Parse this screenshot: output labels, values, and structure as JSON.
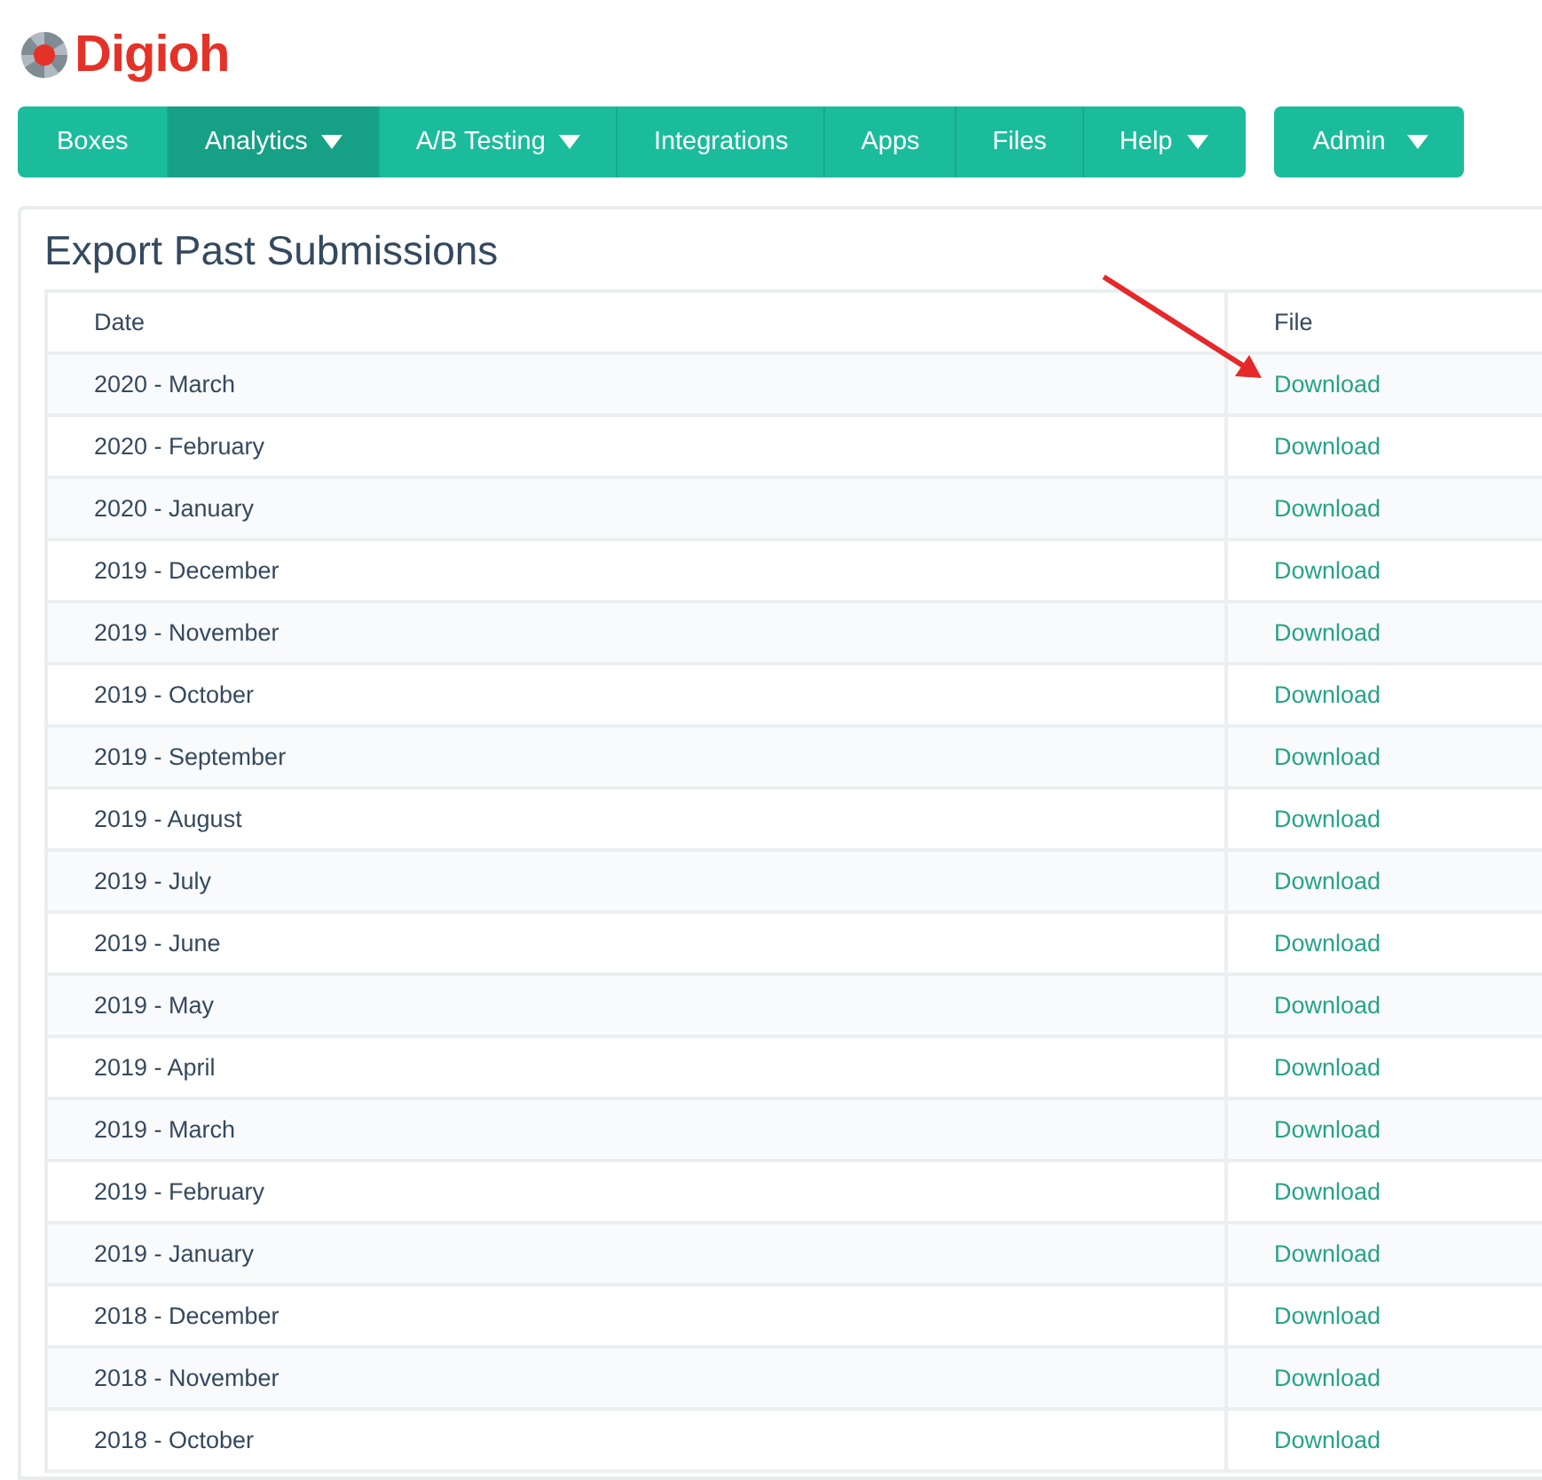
{
  "logo": {
    "text": "Digioh"
  },
  "nav": {
    "items": [
      {
        "label": "Boxes",
        "selected": false,
        "dropdown": false
      },
      {
        "label": "Analytics",
        "selected": true,
        "dropdown": true
      },
      {
        "label": "A/B Testing",
        "selected": false,
        "dropdown": true
      },
      {
        "label": "Integrations",
        "selected": false,
        "dropdown": false
      },
      {
        "label": "Apps",
        "selected": false,
        "dropdown": false
      },
      {
        "label": "Files",
        "selected": false,
        "dropdown": false
      },
      {
        "label": "Help",
        "selected": false,
        "dropdown": true
      }
    ],
    "admin": {
      "label": "Admin",
      "dropdown": true
    }
  },
  "panel": {
    "title": "Export Past Submissions",
    "table": {
      "columns": [
        "Date",
        "File"
      ],
      "rows": [
        [
          "2020 - March",
          "Download"
        ],
        [
          "2020 - February",
          "Download"
        ],
        [
          "2020 - January",
          "Download"
        ],
        [
          "2019 - December",
          "Download"
        ],
        [
          "2019 - November",
          "Download"
        ],
        [
          "2019 - October",
          "Download"
        ],
        [
          "2019 - September",
          "Download"
        ],
        [
          "2019 - August",
          "Download"
        ],
        [
          "2019 - July",
          "Download"
        ],
        [
          "2019 - June",
          "Download"
        ],
        [
          "2019 - May",
          "Download"
        ],
        [
          "2019 - April",
          "Download"
        ],
        [
          "2019 - March",
          "Download"
        ],
        [
          "2019 - February",
          "Download"
        ],
        [
          "2019 - January",
          "Download"
        ],
        [
          "2018 - December",
          "Download"
        ],
        [
          "2018 - November",
          "Download"
        ],
        [
          "2018 - October",
          "Download"
        ]
      ]
    }
  }
}
